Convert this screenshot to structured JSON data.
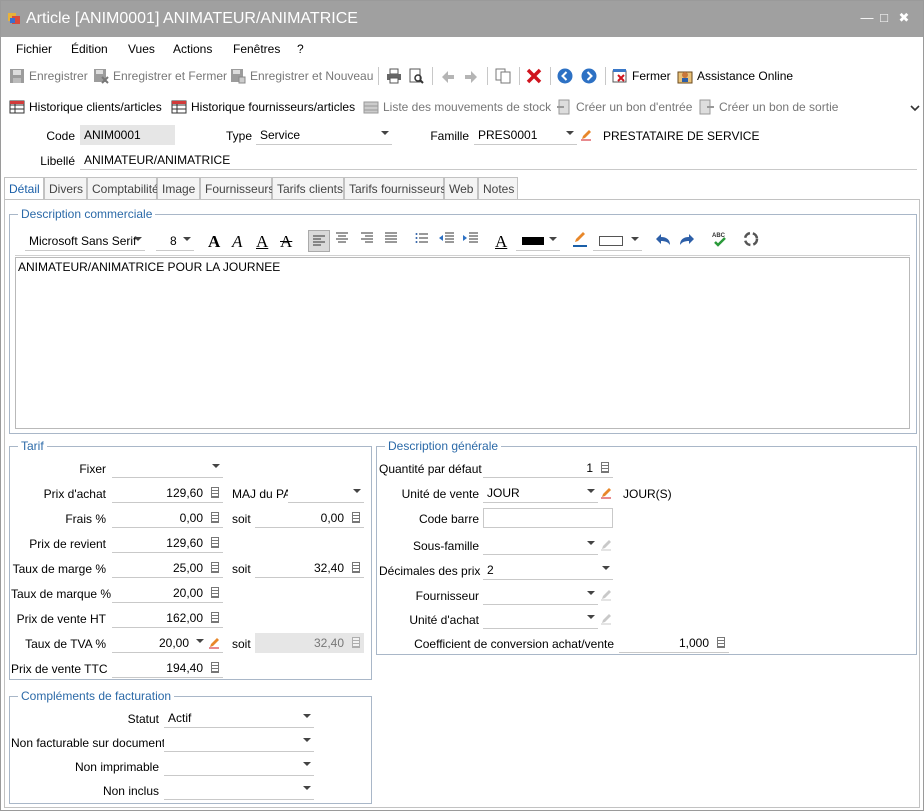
{
  "window": {
    "title": "Article [ANIM0001] ANIMATEUR/ANIMATRICE",
    "controls": [
      "—",
      "□",
      "✖"
    ]
  },
  "menu": [
    "Fichier",
    "Édition",
    "Vues",
    "Actions",
    "Fenêtres",
    "?"
  ],
  "toolbar1": {
    "save": "Enregistrer",
    "save_close": "Enregistrer et Fermer",
    "save_new": "Enregistrer et Nouveau",
    "close": "Fermer",
    "assistance": "Assistance Online"
  },
  "toolbar2": {
    "hist_clients": "Historique clients/articles",
    "hist_suppliers": "Historique fournisseurs/articles",
    "stock_moves": "Liste des mouvements de stock",
    "entry_voucher": "Créer un bon d'entrée",
    "exit_voucher": "Créer un bon de sortie"
  },
  "header": {
    "code_label": "Code",
    "code": "ANIM0001",
    "type_label": "Type",
    "type": "Service",
    "famille_label": "Famille",
    "famille": "PRES0001",
    "famille_desc": "PRESTATAIRE DE SERVICE",
    "libelle_label": "Libellé",
    "libelle": "ANIMATEUR/ANIMATRICE"
  },
  "tabs": [
    "Détail",
    "Divers",
    "Comptabilité",
    "Image",
    "Fournisseurs",
    "Tarifs clients",
    "Tarifs fournisseurs",
    "Web",
    "Notes"
  ],
  "active_tab": "Détail",
  "description": {
    "title": "Description commerciale",
    "font": "Microsoft Sans Serif",
    "size": "8",
    "text": "ANIMATEUR/ANIMATRICE POUR LA JOURNEE"
  },
  "tarif": {
    "title": "Tarif",
    "fixer_label": "Fixer",
    "fixer": "",
    "prix_achat_label": "Prix d'achat",
    "prix_achat": "129,60",
    "maj_pa_label": "MAJ du PA",
    "maj_pa": "",
    "frais_label": "Frais %",
    "frais": "0,00",
    "frais_soit_label": "soit",
    "frais_soit": "0,00",
    "prix_revient_label": "Prix de revient",
    "prix_revient": "129,60",
    "taux_marge_label": "Taux de marge %",
    "taux_marge": "25,00",
    "marge_soit_label": "soit",
    "marge_soit": "32,40",
    "taux_marque_label": "Taux de marque %",
    "taux_marque": "20,00",
    "pv_ht_label": "Prix de vente HT",
    "pv_ht": "162,00",
    "tva_label": "Taux de TVA %",
    "tva": "20,00",
    "tva_soit_label": "soit",
    "tva_soit": "32,40",
    "pv_ttc_label": "Prix de vente TTC",
    "pv_ttc": "194,40"
  },
  "general": {
    "title": "Description générale",
    "qte_label": "Quantité par défaut",
    "qte": "1",
    "unite_vente_label": "Unité de vente",
    "unite_vente": "JOUR",
    "unite_vente_desc": "JOUR(S)",
    "code_barre_label": "Code barre",
    "code_barre": "",
    "sous_famille_label": "Sous-famille",
    "sous_famille": "",
    "decimales_label": "Décimales des prix",
    "decimales": "2",
    "fournisseur_label": "Fournisseur",
    "fournisseur": "",
    "unite_achat_label": "Unité d'achat",
    "unite_achat": "",
    "coef_label": "Coefficient de conversion achat/vente",
    "coef": "1,000"
  },
  "complements": {
    "title": "Compléments de facturation",
    "statut_label": "Statut",
    "statut": "Actif",
    "non_fact_label": "Non facturable sur documents",
    "non_fact": "",
    "non_imp_label": "Non imprimable",
    "non_imp": "",
    "non_inclus_label": "Non inclus",
    "non_inclus": ""
  }
}
